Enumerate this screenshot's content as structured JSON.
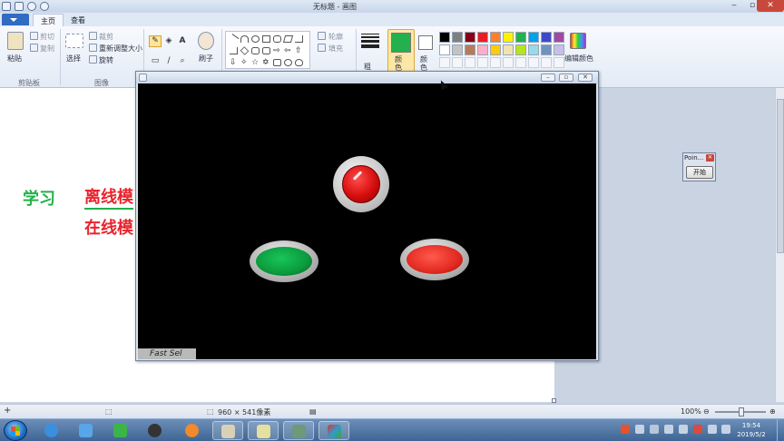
{
  "window": {
    "title": "无标题 - 画图",
    "minimize_icon": "minimize-icon",
    "maximize_icon": "restore-icon",
    "close_icon": "close-icon"
  },
  "ribbon": {
    "tabs": [
      {
        "label": "主页",
        "active": true
      },
      {
        "label": "查看",
        "active": false
      }
    ],
    "clipboard": {
      "paste": "粘贴",
      "cut": "剪切",
      "copy": "复制",
      "group": "剪贴板"
    },
    "image": {
      "select": "选择",
      "crop": "裁剪",
      "resize": "重新调整大小",
      "rotate": "旋转",
      "group": "图像"
    },
    "tools": {
      "brush": "刷子"
    },
    "shapes": {
      "outline": "轮廓",
      "fill": "填充"
    },
    "size": {
      "label": "粗细"
    },
    "colors": {
      "color1": "颜色 1",
      "color2": "颜色 2",
      "edit": "编辑颜色",
      "color1_value": "#22b14c",
      "color2_value": "#ffffff",
      "palette": [
        "#000000",
        "#7f7f7f",
        "#880015",
        "#ed1c24",
        "#ff7f27",
        "#fff200",
        "#22b14c",
        "#00a2e8",
        "#3f48cc",
        "#a349a4",
        "#ffffff",
        "#c3c3c3",
        "#b97a57",
        "#ffaec9",
        "#ffc90e",
        "#efe4b0",
        "#b5e61d",
        "#99d9ea",
        "#7092be",
        "#c8bfe7"
      ]
    }
  },
  "canvas": {
    "text_study": "学习",
    "text_offline": "离线模",
    "text_online": "在线模",
    "text_study_color": "#22b14c",
    "text_mode_color": "#e8242c"
  },
  "fastsel_window": {
    "label": "Fast Sel",
    "round_button_color": "#d60d0d",
    "green_button_color": "#0b9a3d",
    "red_button_color": "#e22a22"
  },
  "point_window": {
    "title": "Poin...",
    "start_button": "开始"
  },
  "statusbar": {
    "dimensions": "960 × 541像素",
    "zoom": "100%"
  },
  "taskbar": {
    "clock_time": "19:54",
    "clock_date": "2019/5/2"
  }
}
